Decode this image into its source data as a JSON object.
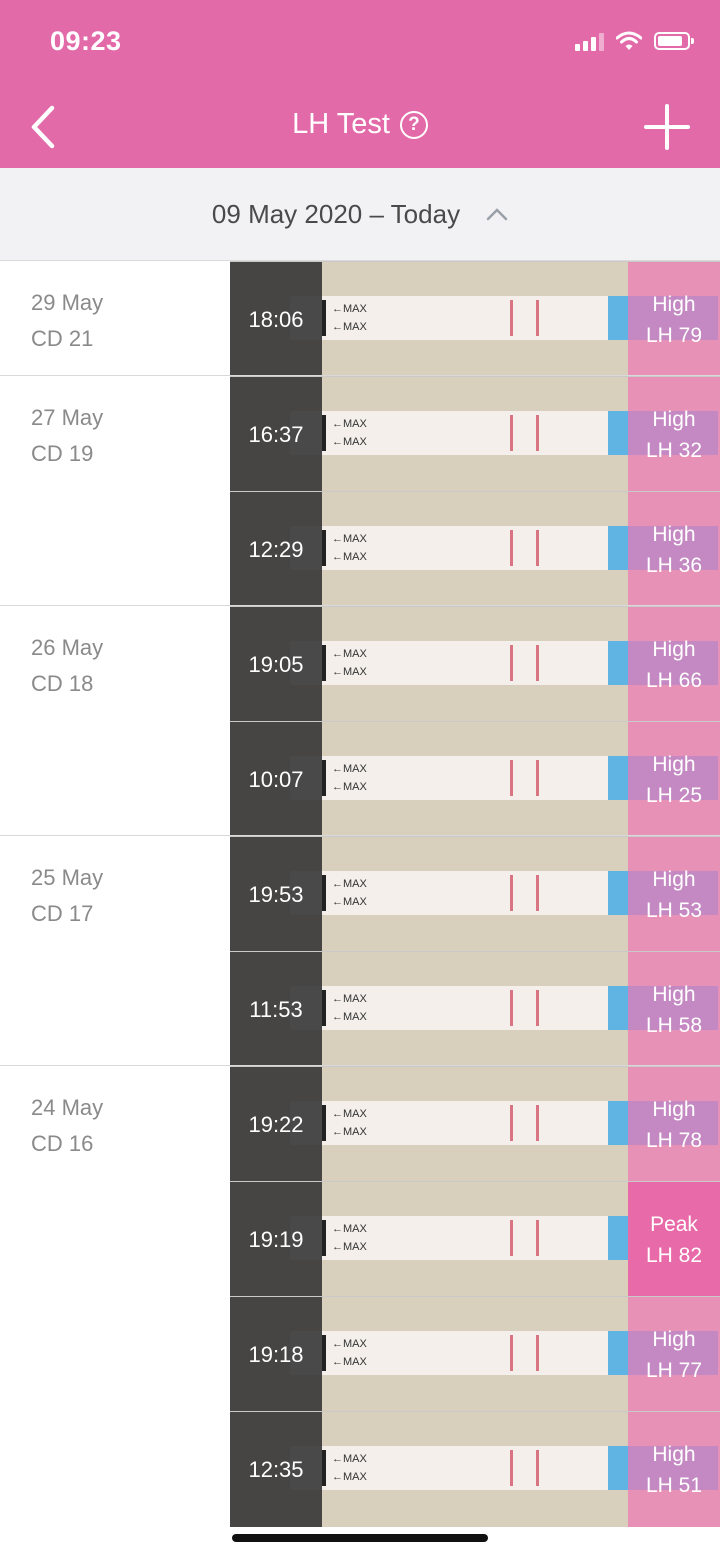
{
  "status": {
    "time": "09:23"
  },
  "header": {
    "title": "LH Test",
    "help": "?"
  },
  "range": {
    "label": "09 May 2020 – Today"
  },
  "colors": {
    "brand": "#e36aa9",
    "overlay": "#ec78b4",
    "peak": "#e86aa8"
  },
  "strip": {
    "max_label": "←MAX"
  },
  "days": [
    {
      "date": "29 May",
      "cd": "CD 21",
      "entries": [
        {
          "time": "18:06",
          "level": "High",
          "value": "LH 79"
        }
      ]
    },
    {
      "date": "27 May",
      "cd": "CD 19",
      "entries": [
        {
          "time": "16:37",
          "level": "High",
          "value": "LH 32"
        },
        {
          "time": "12:29",
          "level": "High",
          "value": "LH 36"
        }
      ]
    },
    {
      "date": "26 May",
      "cd": "CD 18",
      "entries": [
        {
          "time": "19:05",
          "level": "High",
          "value": "LH 66"
        },
        {
          "time": "10:07",
          "level": "High",
          "value": "LH 25"
        }
      ]
    },
    {
      "date": "25 May",
      "cd": "CD 17",
      "entries": [
        {
          "time": "19:53",
          "level": "High",
          "value": "LH 53"
        },
        {
          "time": "11:53",
          "level": "High",
          "value": "LH 58"
        }
      ]
    },
    {
      "date": "24 May",
      "cd": "CD 16",
      "entries": [
        {
          "time": "19:22",
          "level": "High",
          "value": "LH 78"
        },
        {
          "time": "19:19",
          "level": "Peak",
          "value": "LH 82"
        },
        {
          "time": "19:18",
          "level": "High",
          "value": "LH 77"
        },
        {
          "time": "12:35",
          "level": "High",
          "value": "LH 51"
        }
      ]
    }
  ]
}
